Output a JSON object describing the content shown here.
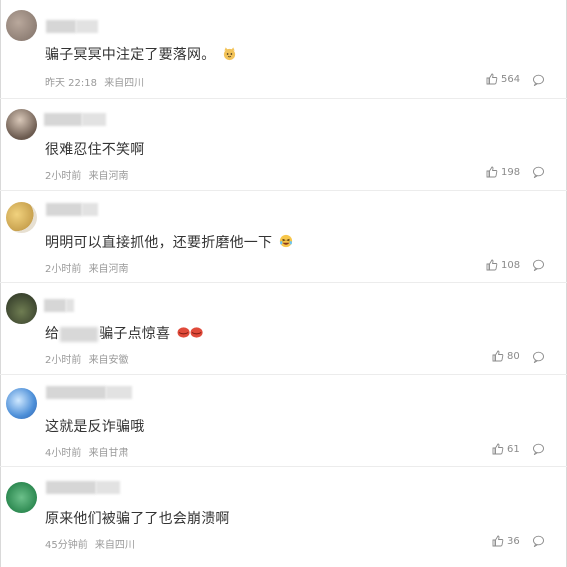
{
  "comments": [
    {
      "text": "骗子冥冥中注定了要落网。",
      "emoji": "cat-face-emoji",
      "time": "昨天 22:18",
      "location": "来自四川",
      "likes": "564"
    },
    {
      "text": "很难忍住不笑啊",
      "time": "2小时前",
      "location": "来自河南",
      "likes": "198"
    },
    {
      "text": "明明可以直接抓他，还要折磨他一下",
      "emoji": "laughing-emoji",
      "time": "2小时前",
      "location": "来自河南",
      "likes": "108"
    },
    {
      "text_prefix": "给",
      "text_suffix": "骗子点惊喜",
      "emoji": "red-lips-emoji",
      "time": "2小时前",
      "location": "来自安徽",
      "likes": "80"
    },
    {
      "text": "这就是反诈骗哦",
      "time": "4小时前",
      "location": "来自甘肃",
      "likes": "61"
    },
    {
      "text": "原来他们被骗了了也会崩溃啊",
      "time": "45分钟前",
      "location": "来自四川",
      "likes": "36"
    }
  ],
  "colors": {
    "text": "#333333",
    "meta": "#9a9a9a",
    "divider": "#ececec"
  },
  "icons": {
    "like": "thumbs-up-icon",
    "reply": "comment-bubble-icon"
  }
}
